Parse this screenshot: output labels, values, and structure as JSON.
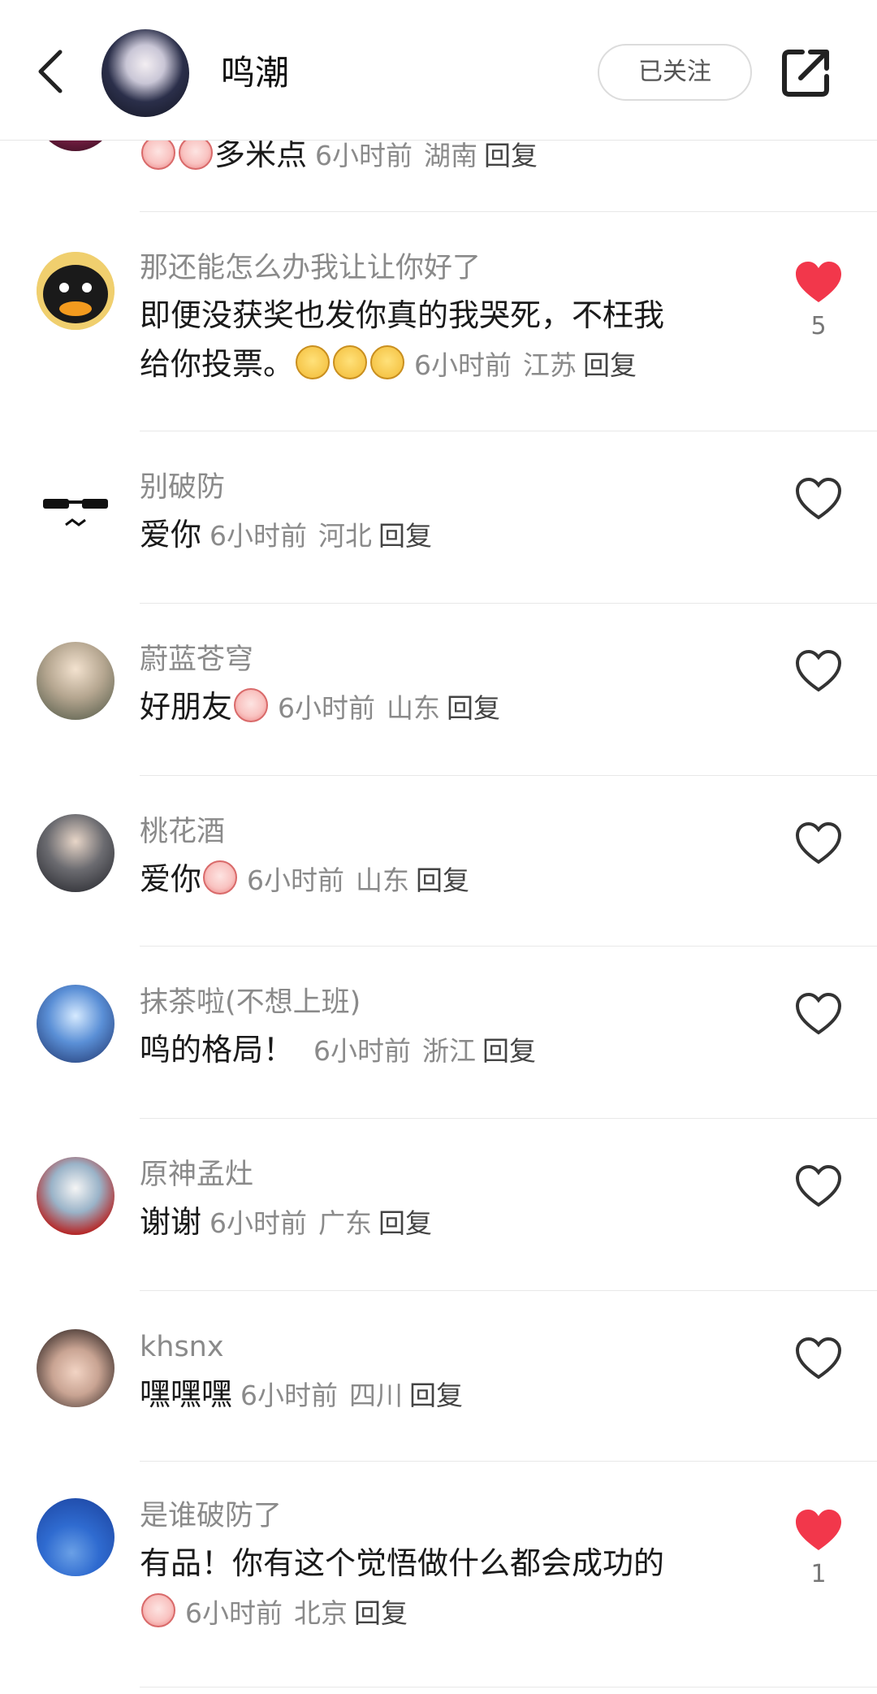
{
  "header": {
    "title": "鸣潮",
    "follow_label": "已关注",
    "back_icon": "chevron-left-icon",
    "share_icon": "share-icon"
  },
  "colors": {
    "liked": "#f2374b",
    "meta": "#8a8a8a"
  },
  "top_partial": {
    "text": "多米点",
    "time": "6小时前",
    "location": "湖南",
    "reply": "回复"
  },
  "comments": [
    {
      "username": "那还能怎么办我让让你好了",
      "text_line1": "即便没获奖也发你真的我哭死，不枉我",
      "text_line2": "给你投票。",
      "emoji": [
        "loudly-crying-face",
        "loudly-crying-face",
        "loudly-crying-face"
      ],
      "time": "6小时前",
      "location": "江苏",
      "reply": "回复",
      "liked": true,
      "likes": "5"
    },
    {
      "username": "别破防",
      "text": "爱你",
      "time": "6小时前",
      "location": "河北",
      "reply": "回复",
      "liked": false
    },
    {
      "username": "蔚蓝苍穹",
      "text": "好朋友",
      "emoji": [
        "pig-face"
      ],
      "time": "6小时前",
      "location": "山东",
      "reply": "回复",
      "liked": false
    },
    {
      "username": "桃花酒",
      "text": "爱你",
      "emoji": [
        "pig-face"
      ],
      "time": "6小时前",
      "location": "山东",
      "reply": "回复",
      "liked": false
    },
    {
      "username": "抹茶啦(不想上班)",
      "text": "鸣的格局！",
      "time": "6小时前",
      "location": "浙江",
      "reply": "回复",
      "liked": false
    },
    {
      "username": "原神孟灶",
      "text": "谢谢",
      "time": "6小时前",
      "location": "广东",
      "reply": "回复",
      "liked": false
    },
    {
      "username": "khsnx",
      "text": "嘿嘿嘿",
      "time": "6小时前",
      "location": "四川",
      "reply": "回复",
      "liked": false
    },
    {
      "username": "是谁破防了",
      "text_line1": "有品！你有这个觉悟做什么都会成功的",
      "emoji": [
        "pig-face"
      ],
      "time": "6小时前",
      "location": "北京",
      "reply": "回复",
      "liked": true,
      "likes": "1"
    }
  ]
}
